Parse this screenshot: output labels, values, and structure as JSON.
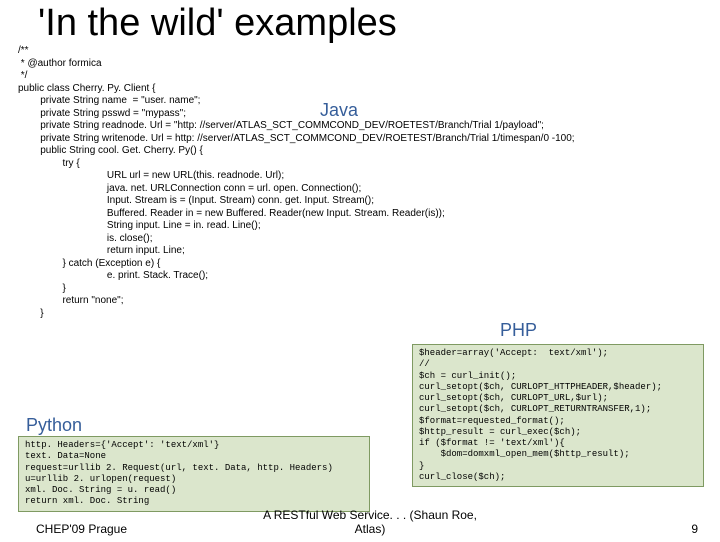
{
  "title": "'In the wild' examples",
  "labels": {
    "java": "Java",
    "php": "PHP",
    "python": "Python"
  },
  "java_code": "/**\n * @author formica\n */\npublic class Cherry. Py. Client {\n        private String name  = \"user. name\";\n        private String psswd = \"mypass\";\n        private String readnode. Url = \"http: //server/ATLAS_SCT_COMMCOND_DEV/ROETEST/Branch/Trial 1/payload\";\n        private String writenode. Url = http: //server/ATLAS_SCT_COMMCOND_DEV/ROETEST/Branch/Trial 1/timespan/0 -100;\n        public String cool. Get. Cherry. Py() {\n                try {\n                                URL url = new URL(this. readnode. Url);\n                                java. net. URLConnection conn = url. open. Connection();\n                                Input. Stream is = (Input. Stream) conn. get. Input. Stream();\n                                Buffered. Reader in = new Buffered. Reader(new Input. Stream. Reader(is));\n                                String input. Line = in. read. Line();\n                                is. close();\n                                return input. Line;\n                } catch (Exception e) {\n                                e. print. Stack. Trace();\n                }\n                return \"none\";\n        }",
  "php_code": "$header=array('Accept:  text/xml');\n//\n$ch = curl_init();\ncurl_setopt($ch, CURLOPT_HTTPHEADER,$header);\ncurl_setopt($ch, CURLOPT_URL,$url);\ncurl_setopt($ch, CURLOPT_RETURNTRANSFER,1);\n$format=requested_format();\n$http_result = curl_exec($ch);\nif ($format != 'text/xml'){\n    $dom=domxml_open_mem($http_result);\n}\ncurl_close($ch);",
  "python_code": "http. Headers={'Accept': 'text/xml'}\ntext. Data=None\nrequest=urllib 2. Request(url, text. Data, http. Headers)\nu=urllib 2. urlopen(request)\nxml. Doc. String = u. read()\nreturn xml. Doc. String",
  "footer": {
    "left": "CHEP'09 Prague",
    "center": "A RESTful Web Service. . . (Shaun Roe, Atlas)",
    "page": "9"
  }
}
